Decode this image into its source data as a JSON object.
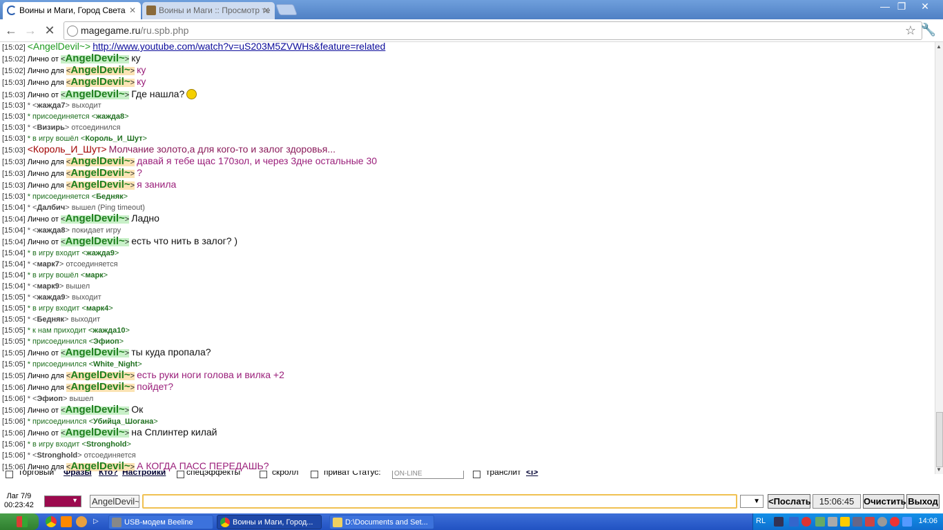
{
  "browser": {
    "tabs": [
      {
        "title": "Воины и Маги, Город Света"
      },
      {
        "title": "Воины и Маги :: Просмотр те"
      }
    ],
    "url_host": "magegame.ru",
    "url_path": "/ru.spb.php"
  },
  "chat": {
    "private_from_label": "Лично от",
    "private_for_label": "Лично для",
    "lines": [
      {
        "ts": "[15:02]",
        "type": "public-link",
        "nick": "<AngelDevil~>",
        "text": "http://www.youtube.com/watch?v=uS203M5ZVWHs&feature=related"
      },
      {
        "ts": "[15:02]",
        "type": "from",
        "nick": "AngelDevil~",
        "text": "ку"
      },
      {
        "ts": "[15:02]",
        "type": "for",
        "nick": "AngelDevil~",
        "text": "ку"
      },
      {
        "ts": "[15:03]",
        "type": "for",
        "nick": "AngelDevil~",
        "text": "ку"
      },
      {
        "ts": "[15:03]",
        "type": "from",
        "nick": "AngelDevil~",
        "text": "Где нашла?",
        "smiley": true
      },
      {
        "ts": "[15:03]",
        "type": "sys",
        "pre": "* <",
        "nick": "жажда7",
        "post": "> выходит"
      },
      {
        "ts": "[15:03]",
        "type": "sysg",
        "pre": "* присоединяется <",
        "nick": "жажда8",
        "post": ">"
      },
      {
        "ts": "[15:03]",
        "type": "sys",
        "pre": "* <",
        "nick": "Визирь",
        "post": "> отсоединился"
      },
      {
        "ts": "[15:03]",
        "type": "sysg",
        "pre": "* в игру вошёл <",
        "nick": "Король_И_Шут",
        "post": ">"
      },
      {
        "ts": "[15:03]",
        "type": "public-king",
        "nick": "<Король_И_Шут>",
        "text": "Молчание золото,а для кого-то и залог здоровья..."
      },
      {
        "ts": "[15:03]",
        "type": "for",
        "nick": "AngelDevil~",
        "text": "давай я тебе щас 170зол, и через 3дне остальные 30"
      },
      {
        "ts": "[15:03]",
        "type": "for",
        "nick": "AngelDevil~",
        "text": "?"
      },
      {
        "ts": "[15:03]",
        "type": "for",
        "nick": "AngelDevil~",
        "text": "я занила"
      },
      {
        "ts": "[15:03]",
        "type": "sysg",
        "pre": "* присоединяется <",
        "nick": "Бедняк",
        "post": ">"
      },
      {
        "ts": "[15:04]",
        "type": "sys",
        "pre": "* <",
        "nick": "Далбич",
        "post": "> вышел (Ping timeout)"
      },
      {
        "ts": "[15:04]",
        "type": "from",
        "nick": "AngelDevil~",
        "text": "Ладно"
      },
      {
        "ts": "[15:04]",
        "type": "sys",
        "pre": "* <",
        "nick": "жажда8",
        "post": "> покидает игру"
      },
      {
        "ts": "[15:04]",
        "type": "from",
        "nick": "AngelDevil~",
        "text": "есть что нить в залог? )"
      },
      {
        "ts": "[15:04]",
        "type": "sysg",
        "pre": "* в игру входит <",
        "nick": "жажда9",
        "post": ">"
      },
      {
        "ts": "[15:04]",
        "type": "sys",
        "pre": "* <",
        "nick": "марк7",
        "post": "> отсоединяется"
      },
      {
        "ts": "[15:04]",
        "type": "sysg",
        "pre": "* в игру вошёл <",
        "nick": "марк",
        "post": ">"
      },
      {
        "ts": "[15:04]",
        "type": "sys",
        "pre": "* <",
        "nick": "марк9",
        "post": "> вышел"
      },
      {
        "ts": "[15:05]",
        "type": "sys",
        "pre": "* <",
        "nick": "жажда9",
        "post": "> выходит"
      },
      {
        "ts": "[15:05]",
        "type": "sysg",
        "pre": "* в игру входит <",
        "nick": "марк4",
        "post": ">"
      },
      {
        "ts": "[15:05]",
        "type": "sys",
        "pre": "* <",
        "nick": "Бедняк",
        "post": "> выходит"
      },
      {
        "ts": "[15:05]",
        "type": "sysg",
        "pre": "* к нам приходит <",
        "nick": "жажда10",
        "post": ">"
      },
      {
        "ts": "[15:05]",
        "type": "sysg",
        "pre": "* присоединился <",
        "nick": "Эфиоп",
        "post": ">"
      },
      {
        "ts": "[15:05]",
        "type": "from",
        "nick": "AngelDevil~",
        "text": "ты куда пропала?"
      },
      {
        "ts": "[15:05]",
        "type": "sysg",
        "pre": "* присоединился <",
        "nick": "White_Night",
        "post": ">"
      },
      {
        "ts": "[15:05]",
        "type": "for",
        "nick": "AngelDevil~",
        "text": "есть руки ноги голова и вилка +2"
      },
      {
        "ts": "[15:06]",
        "type": "for",
        "nick": "AngelDevil~",
        "text": "пойдет?"
      },
      {
        "ts": "[15:06]",
        "type": "sys",
        "pre": "* <",
        "nick": "Эфиоп",
        "post": "> вышел"
      },
      {
        "ts": "[15:06]",
        "type": "from",
        "nick": "AngelDevil~",
        "text": "Ок"
      },
      {
        "ts": "[15:06]",
        "type": "sysg",
        "pre": "* присоединился <",
        "nick": "Убийца_Шогана",
        "post": ">"
      },
      {
        "ts": "[15:06]",
        "type": "from",
        "nick": "AngelDevil~",
        "text": "на Сплинтер килай"
      },
      {
        "ts": "[15:06]",
        "type": "sysg",
        "pre": "* в игру входит <",
        "nick": "Stronghold",
        "post": ">"
      },
      {
        "ts": "[15:06]",
        "type": "sys",
        "pre": "* <",
        "nick": "Stronghold",
        "post": "> отсоединяется"
      },
      {
        "ts": "[15:06]",
        "type": "for",
        "nick": "AngelDevil~",
        "text": "А КОГДА ПАСС ПЕРЕДАШЬ?"
      }
    ]
  },
  "options": {
    "trade": "Торговый",
    "phrases": "Фразы",
    "who": "Кто?",
    "settings": "Настройки",
    "effects": "спецэффекты",
    "scroll": "скролл",
    "private_status": "приват Статус:",
    "status_value": "ON-LINE",
    "translit": "транслит",
    "translit_link": "<i>"
  },
  "bottom": {
    "lag": "Лаг 7/9",
    "uptime": "00:23:42",
    "color": "#9c0a4e",
    "nick": "AngelDevil~",
    "message": "",
    "send": "<Послать",
    "time": "15:06:45",
    "clear": "Очистить",
    "exit": "Выход"
  },
  "taskbar": {
    "tasks": [
      {
        "title": "USB-модем Beeline"
      },
      {
        "title": "Воины и Маги, Город..."
      },
      {
        "title": "D:\\Documents and Set..."
      }
    ],
    "lang": "RL",
    "clock": "14:06"
  }
}
